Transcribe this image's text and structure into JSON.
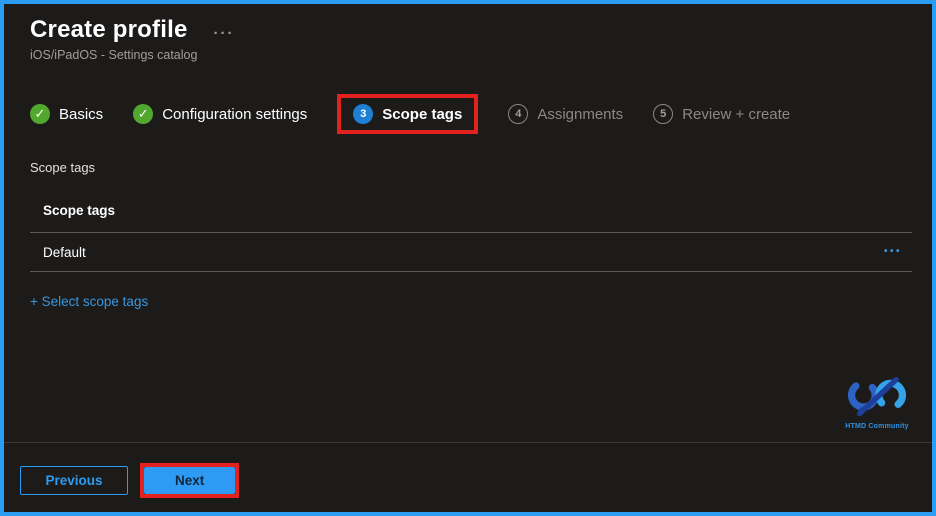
{
  "window": {
    "title": "Create profile",
    "more_icon": "···",
    "subtitle": "iOS/iPadOS - Settings catalog"
  },
  "wizard": {
    "check_icon": "✓",
    "steps": [
      {
        "label": "Basics",
        "status": "complete"
      },
      {
        "label": "Configuration settings",
        "status": "complete"
      },
      {
        "label": "Scope tags",
        "number": "3",
        "status": "current",
        "annotated": true
      },
      {
        "label": "Assignments",
        "number": "4",
        "status": "upcoming"
      },
      {
        "label": "Review + create",
        "number": "5",
        "status": "upcoming"
      }
    ]
  },
  "content": {
    "section_label": "Scope tags",
    "table": {
      "header": "Scope tags",
      "rows": [
        {
          "value": "Default",
          "menu_icon": "•••"
        }
      ]
    },
    "select_link": "+ Select scope tags"
  },
  "branding": {
    "logo_text": "HTMD Community"
  },
  "footer": {
    "previous_label": "Previous",
    "next_label": "Next"
  },
  "colors": {
    "panel_border_blue": "#2b9cf2",
    "annotation_red": "#e3211f",
    "step_complete_green": "#52a82e",
    "step_current_blue": "#1e7fd4",
    "link_blue": "#3a96dd",
    "next_button_blue": "#2e9af3",
    "background_dark": "#1c1b1a"
  }
}
